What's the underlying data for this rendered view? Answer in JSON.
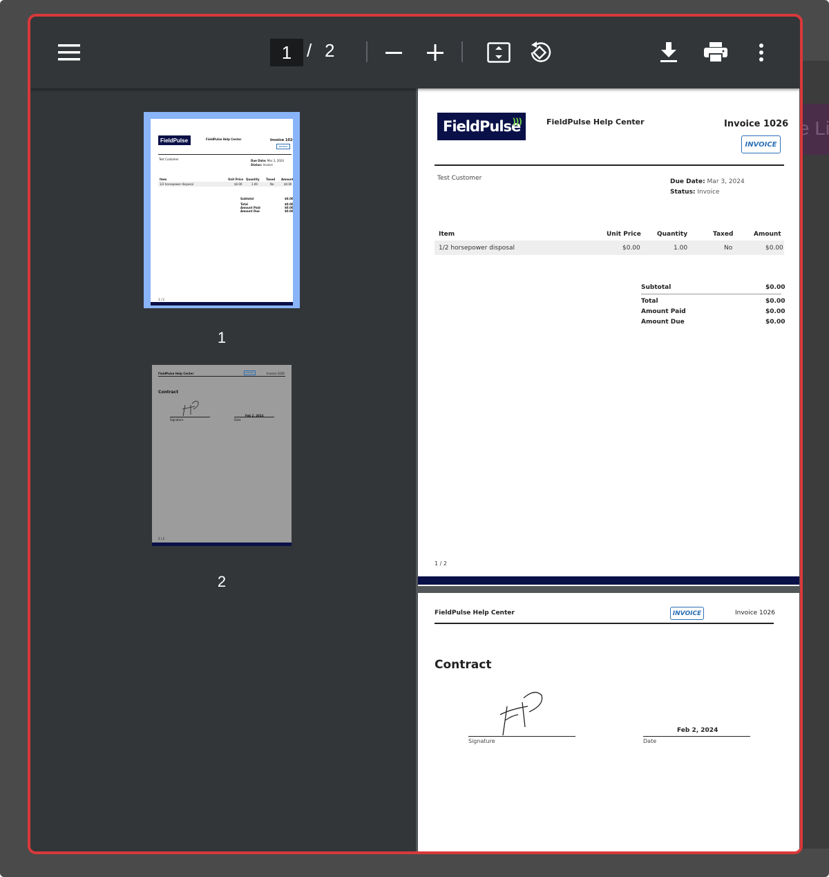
{
  "toolbar": {
    "current_page": "1",
    "separator": "/",
    "total_pages": "2"
  },
  "background": {
    "partial_text": "e Li"
  },
  "thumbnails": [
    {
      "label": "1",
      "selected": true
    },
    {
      "label": "2",
      "selected": false
    }
  ],
  "invoice_page": {
    "company": "FieldPulse Help Center",
    "logo_text": "FieldPulse",
    "invoice_title": "Invoice 1026",
    "badge": "INVOICE",
    "customer": "Test Customer",
    "due_date_label": "Due Date:",
    "due_date_value": "Mar 3, 2024",
    "status_label": "Status:",
    "status_value": "Invoice",
    "table": {
      "headers": [
        "Item",
        "Unit Price",
        "Quantity",
        "Taxed",
        "Amount"
      ],
      "rows": [
        [
          "1/2 horsepower disposal",
          "$0.00",
          "1.00",
          "No",
          "$0.00"
        ]
      ]
    },
    "totals": [
      {
        "label": "Subtotal",
        "value": "$0.00"
      },
      {
        "label": "Total",
        "value": "$0.00"
      },
      {
        "label": "Amount Paid",
        "value": "$0.00"
      },
      {
        "label": "Amount Due",
        "value": "$0.00"
      }
    ],
    "page_indicator": "1 / 2"
  },
  "contract_page": {
    "company": "FieldPulse Help Center",
    "badge": "INVOICE",
    "invoice_title": "Invoice 1026",
    "heading": "Contract",
    "signature_label": "Signature",
    "date_value": "Feb 2, 2024",
    "date_label": "Date",
    "page_indicator": "2 / 2"
  },
  "colors": {
    "accent_border": "#d9393a",
    "toolbar_bg": "#323639",
    "thumb_selected": "#8ab4f8",
    "logo_bg": "#0a1048",
    "badge_blue": "#2a6fb5"
  }
}
